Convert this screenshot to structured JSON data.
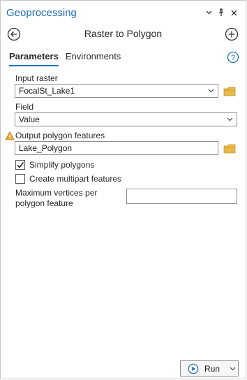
{
  "pane": {
    "title": "Geoprocessing",
    "tool_title": "Raster to Polygon"
  },
  "tabs": [
    {
      "label": "Parameters",
      "active": true
    },
    {
      "label": "Environments",
      "active": false
    }
  ],
  "params": {
    "input_raster": {
      "label": "Input raster",
      "value": "FocalSt_Lake1"
    },
    "field": {
      "label": "Field",
      "value": "Value"
    },
    "output": {
      "label": "Output polygon features",
      "value": "Lake_Polygon",
      "warning": true
    },
    "simplify": {
      "label": "Simplify polygons",
      "checked": true
    },
    "multipart": {
      "label": "Create multipart features",
      "checked": false
    },
    "max_vertices": {
      "label": "Maximum vertices per polygon feature",
      "value": ""
    }
  },
  "run": {
    "label": "Run"
  },
  "icons": {
    "back": "back-arrow-icon",
    "add": "add-circle-icon",
    "help": "help-icon",
    "folder": "folder-icon",
    "warning": "warning-icon",
    "play": "play-icon"
  },
  "colors": {
    "accent": "#1f6fb5",
    "folder": "#e8b84a",
    "warning": "#f0a830"
  }
}
